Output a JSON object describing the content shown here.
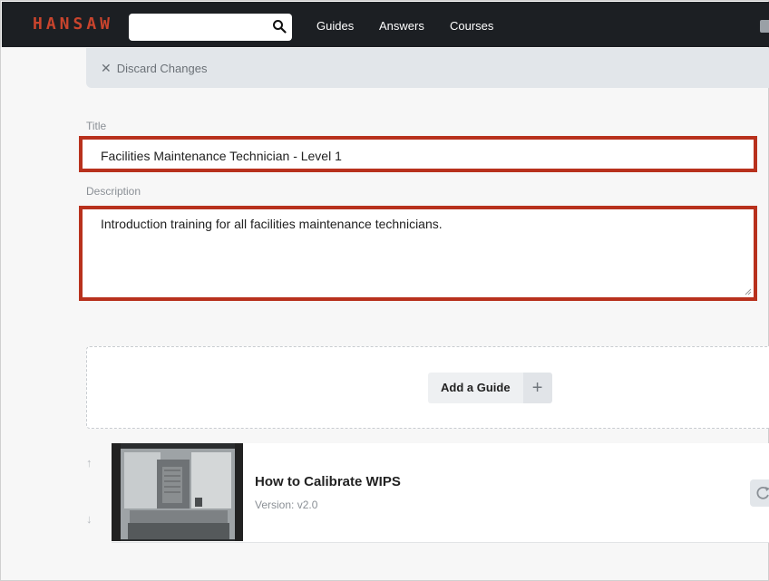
{
  "brand": {
    "logo_text": "HANSAW",
    "accent": "#c9442d"
  },
  "search": {
    "value": "",
    "placeholder": ""
  },
  "nav": {
    "links": [
      "Guides",
      "Answers",
      "Courses"
    ]
  },
  "toolbar": {
    "discard_label": "Discard Changes",
    "discard_icon": "close-icon"
  },
  "form": {
    "title_label": "Title",
    "title_value": "Facilities Maintenance Technician - Level 1",
    "description_label": "Description",
    "description_value": "Introduction training for all facilities maintenance technicians.",
    "highlight_color": "#b8311d"
  },
  "add_guide": {
    "label": "Add a Guide",
    "icon": "plus-icon"
  },
  "guides": [
    {
      "title": "How to Calibrate WIPS",
      "version": "Version: v2.0"
    }
  ],
  "colors": {
    "nav_bg": "#1c1f23",
    "page_bg": "#f7f7f7",
    "toolbar_bg": "#e2e6ea"
  }
}
